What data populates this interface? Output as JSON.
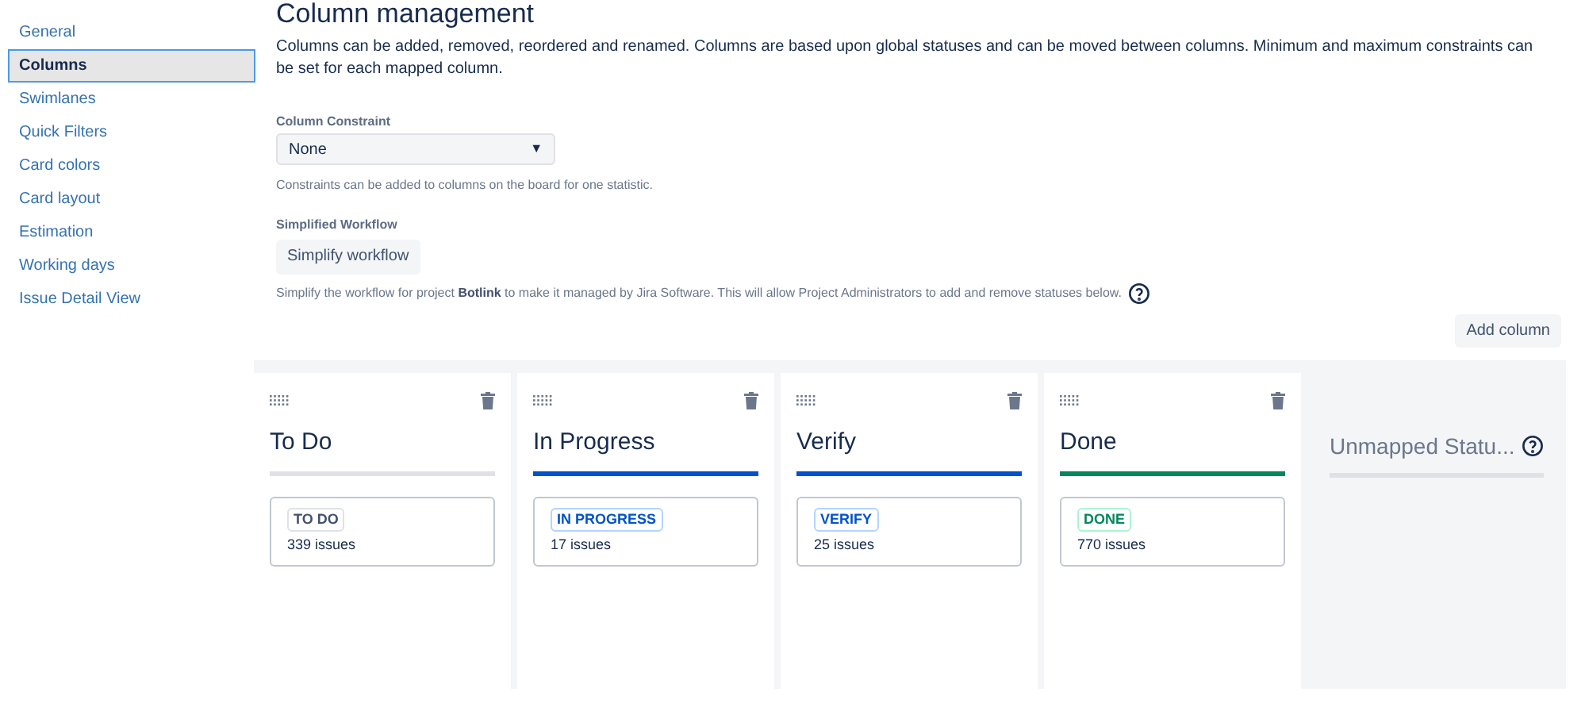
{
  "sidebar": {
    "items": [
      {
        "label": "General",
        "selected": false
      },
      {
        "label": "Columns",
        "selected": true
      },
      {
        "label": "Swimlanes",
        "selected": false
      },
      {
        "label": "Quick Filters",
        "selected": false
      },
      {
        "label": "Card colors",
        "selected": false
      },
      {
        "label": "Card layout",
        "selected": false
      },
      {
        "label": "Estimation",
        "selected": false
      },
      {
        "label": "Working days",
        "selected": false
      },
      {
        "label": "Issue Detail View",
        "selected": false
      }
    ]
  },
  "title": "Column management",
  "description": "Columns can be added, removed, reordered and renamed. Columns are based upon global statuses and can be moved between columns. Minimum and maximum constraints can be set for each mapped column.",
  "constraint": {
    "label": "Column Constraint",
    "value": "None",
    "caret": "▼",
    "help": "Constraints can be added to columns on the board for one statistic."
  },
  "workflow": {
    "label": "Simplified Workflow",
    "button": "Simplify workflow",
    "help": "Simplify the workflow for project **Botlink** to make it managed by Jira Software. This will allow Project Administrators to add and remove statuses below."
  },
  "add_column": "Add column",
  "columns": [
    {
      "kind": "mapped",
      "name": "To Do",
      "color": "#dfe1e6",
      "status": "TO DO",
      "count": "339 issues"
    },
    {
      "kind": "mapped",
      "name": "In Progress",
      "color": "#0052cc",
      "status": "IN PROGRESS",
      "count": "17 issues"
    },
    {
      "kind": "mapped",
      "name": "Verify",
      "color": "#0052cc",
      "status": "VERIFY",
      "count": "25 issues"
    },
    {
      "kind": "mapped",
      "name": "Done",
      "color": "#00875a",
      "status": "DONE",
      "count": "770 issues"
    },
    {
      "kind": "unmapped",
      "name": "Unmapped Statu..."
    }
  ]
}
